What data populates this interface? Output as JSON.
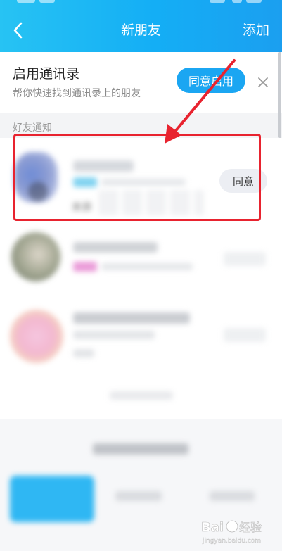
{
  "header": {
    "title": "新朋友",
    "add_label": "添加"
  },
  "contacts_card": {
    "title": "启用通讯录",
    "subtitle": "帮你快速找到通讯录上的朋友",
    "enable_button": "同意启用"
  },
  "section_label": "好友通知",
  "request": {
    "accept_label": "同意",
    "source_label": "来源"
  },
  "colors": {
    "header_start": "#27c3f3",
    "header_end": "#1b9ff0",
    "accent": "#1ba6f2",
    "annotation_red": "#e8232f"
  },
  "watermark": {
    "brand": "Bai",
    "brand_suffix": "经验",
    "site": "jingyan.baidu.com"
  }
}
